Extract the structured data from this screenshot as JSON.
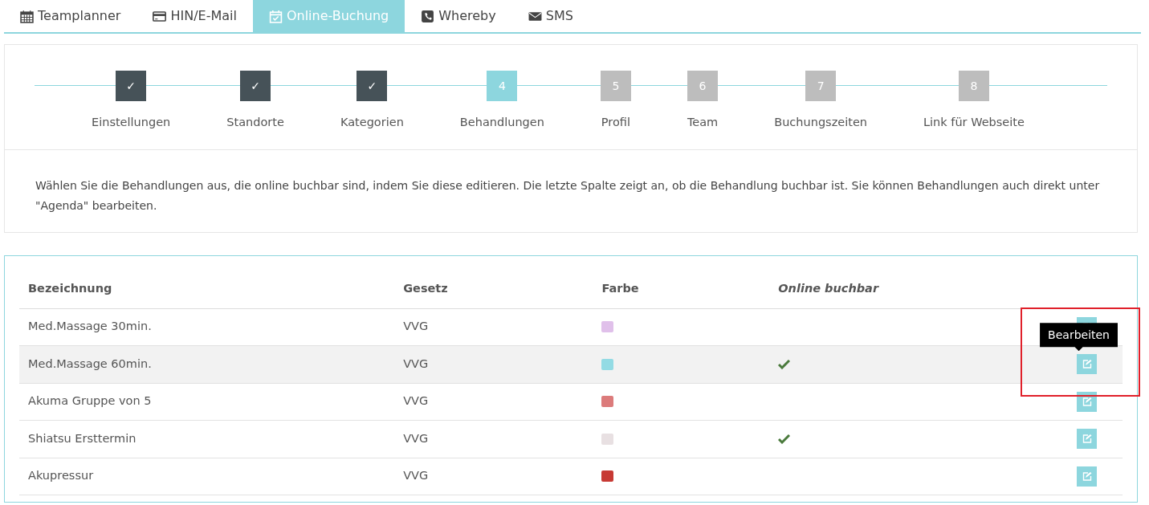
{
  "tabs": [
    {
      "label": "Teamplanner",
      "selected": false
    },
    {
      "label": "HIN/E-Mail",
      "selected": false
    },
    {
      "label": "Online-Buchung",
      "selected": true
    },
    {
      "label": "Whereby",
      "selected": false
    },
    {
      "label": "SMS",
      "selected": false
    }
  ],
  "steps": [
    {
      "marker": "✓",
      "label": "Einstellungen",
      "done": true,
      "selected": false
    },
    {
      "marker": "✓",
      "label": "Standorte",
      "done": true,
      "selected": false
    },
    {
      "marker": "✓",
      "label": "Kategorien",
      "done": true,
      "selected": false
    },
    {
      "marker": "4",
      "label": "Behandlungen",
      "done": false,
      "selected": true
    },
    {
      "marker": "5",
      "label": "Profil",
      "done": false,
      "selected": false
    },
    {
      "marker": "6",
      "label": "Team",
      "done": false,
      "selected": false
    },
    {
      "marker": "7",
      "label": "Buchungszeiten",
      "done": false,
      "selected": false
    },
    {
      "marker": "8",
      "label": "Link für Webseite",
      "done": false,
      "selected": false
    }
  ],
  "intro": "Wählen Sie die Behandlungen aus, die online buchbar sind, indem Sie diese editieren. Die letzte Spalte zeigt an, ob die Behandlung buchbar ist. Sie können Behandlungen auch direkt unter \"Agenda\" bearbeiten.",
  "table": {
    "columns": [
      "Bezeichnung",
      "Gesetz",
      "Farbe",
      "Online buchbar"
    ],
    "rows": [
      {
        "name": "Med.Massage 30min.",
        "law": "VVG",
        "color": "#e0c0ea",
        "bookable": false,
        "highlighted": false
      },
      {
        "name": "Med.Massage 60min.",
        "law": "VVG",
        "color": "#93dbe4",
        "bookable": true,
        "highlighted": true,
        "tooltip": "Bearbeiten"
      },
      {
        "name": "Akuma Gruppe von 5",
        "law": "VVG",
        "color": "#dc7b7b",
        "bookable": false,
        "highlighted": false
      },
      {
        "name": "Shiatsu Ersttermin",
        "law": "VVG",
        "color": "#e8e0e2",
        "bookable": true,
        "highlighted": false
      },
      {
        "name": "Akupressur",
        "law": "VVG",
        "color": "#c73a34",
        "bookable": false,
        "highlighted": false
      }
    ]
  }
}
